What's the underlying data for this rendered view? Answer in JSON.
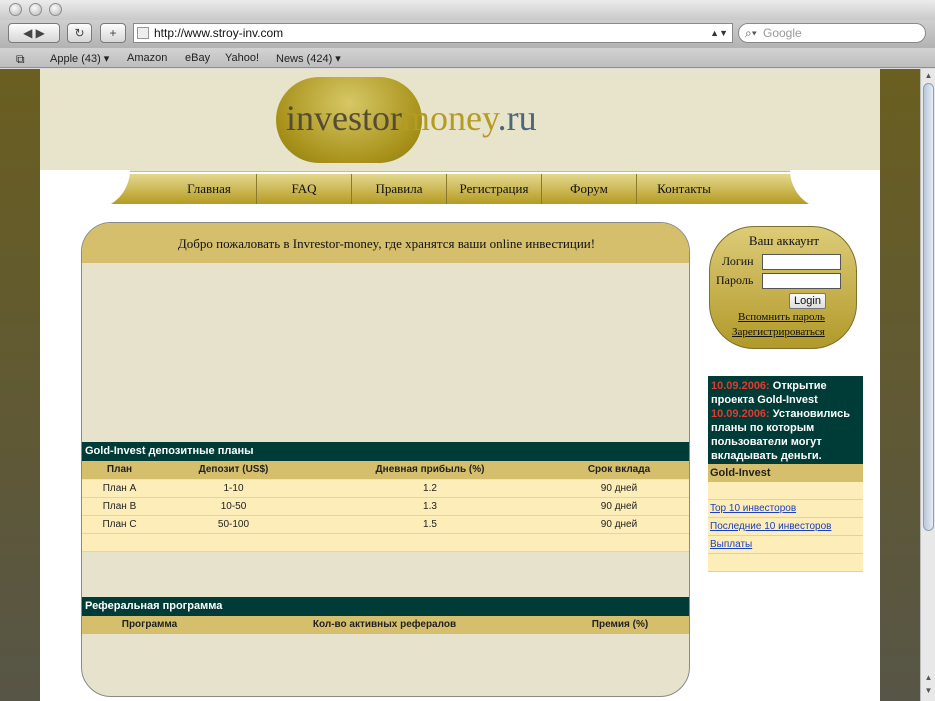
{
  "browser": {
    "url": "http://www.stroy-inv.com",
    "search_placeholder": "Google",
    "bookmarks": [
      "Apple (43) ▾",
      "Amazon",
      "eBay",
      "Yahoo!",
      "News (424) ▾"
    ]
  },
  "site": {
    "logo": {
      "part1": "investor",
      "part2": "money",
      "part3": ".ru"
    },
    "nav": [
      "Главная",
      "FAQ",
      "Правила",
      "Регистрация",
      "Форум",
      "Контакты"
    ],
    "welcome": "Добро пожаловать в Invrestor-money, где хранятся ваши online инвестиции!",
    "deposit": {
      "title": "Gold-Invest депозитные планы",
      "headers": [
        "План",
        "Депозит (US$)",
        "Дневная прибыль (%)",
        "Срок вклада"
      ],
      "rows": [
        [
          "План A",
          "1-10",
          "1.2",
          "90 дней"
        ],
        [
          "План B",
          "10-50",
          "1.3",
          "90 дней"
        ],
        [
          "План C",
          "50-100",
          "1.5",
          "90 дней"
        ]
      ]
    },
    "referral": {
      "title": "Реферальная программа",
      "headers": [
        "Программа",
        "Кол-во активных рефералов",
        "Премия (%)"
      ]
    },
    "account": {
      "title": "Ваш аккаунт",
      "login_label": "Логин",
      "password_label": "Пароль",
      "login_button": "Login",
      "remind": "Вспомнить пароль",
      "register": "Зарегистрироваться"
    },
    "news": [
      {
        "date": "10.09.2006:",
        "text": " Открытие проекта Gold-Invest"
      },
      {
        "date": "10.09.2006:",
        "text": " Установились планы по которым пользователи могут вкладывать деньги."
      }
    ],
    "sidebar": {
      "title": "Gold-Invest",
      "links": [
        "Top 10 инвесторов",
        "Последние 10 инвесторов",
        "Выплаты"
      ]
    }
  }
}
